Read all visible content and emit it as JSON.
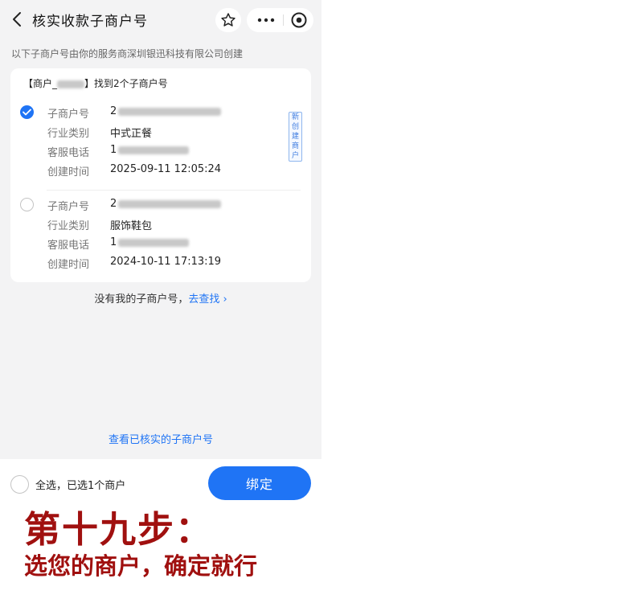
{
  "header": {
    "title": "核实收款子商户号"
  },
  "intro_text": "以下子商户号由你的服务商深圳银迅科技有限公司创建",
  "card": {
    "head_prefix": "【商户_",
    "head_suffix": "】找到2个子商户号",
    "labels": {
      "merchant_no": "子商户号",
      "industry": "行业类别",
      "phone": "客服电话",
      "created": "创建时间"
    },
    "entries": [
      {
        "selected": true,
        "merchant_no_prefix": "2",
        "badge": "新创建商户",
        "industry": "中式正餐",
        "phone_prefix": "1",
        "created": "2025-09-11 12:05:24"
      },
      {
        "selected": false,
        "merchant_no_prefix": "2",
        "industry": "服饰鞋包",
        "phone_prefix": "1",
        "created": "2024-10-11 17:13:19"
      }
    ]
  },
  "not_found": {
    "text": "没有我的子商户号，",
    "link": "去查找 ›"
  },
  "verified_link": "查看已核实的子商户号",
  "footer": {
    "select_all": "全选，已选1个商户",
    "bind_button": "绑定"
  },
  "caption": {
    "line1": "第十九步：",
    "line2": "选您的商户，确定就行"
  },
  "colors": {
    "accent": "#1f74f5",
    "caption": "#a0100f",
    "background": "#f3f3f4"
  },
  "icons": {
    "back": "chevron-left-icon",
    "star": "star-icon",
    "more": "more-dots-icon",
    "eye": "target-icon",
    "check": "check-icon"
  }
}
